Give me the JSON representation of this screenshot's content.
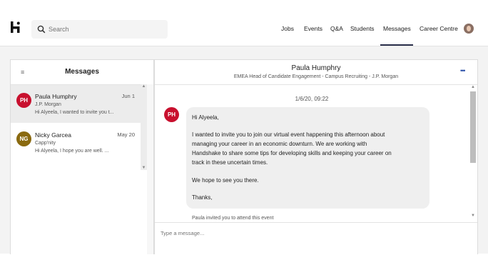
{
  "search": {
    "placeholder": "Search",
    "icon": "search-icon"
  },
  "nav": {
    "items": [
      "Jobs",
      "Events",
      "Q&A",
      "Students",
      "Messages",
      "Career Centre"
    ],
    "active": "Messages"
  },
  "messages_panel": {
    "title": "Messages",
    "menu_icon": "≡",
    "conversations": [
      {
        "initials": "PH",
        "name": "Paula Humphry",
        "date": "Jun 1",
        "subtitle": "J.P. Morgan",
        "preview": "Hi Alyeela, I wanted to invite you t...",
        "avatar_color": "#c8102e"
      },
      {
        "initials": "NG",
        "name": "Nicky Garcea",
        "date": "May 20",
        "subtitle": "Capp'nity",
        "preview": "Hi Alyeela, I hope you are well. ...",
        "avatar_color": "#8a6a10"
      }
    ]
  },
  "conversation": {
    "contact_name": "Paula Humphry",
    "contact_title": "EMEA Head of Candidate Engagement - Campus Recruiting - J.P. Morgan",
    "more_icon": "•••",
    "timestamp": "1/6/20, 09:22",
    "sender_initials": "PH",
    "message": {
      "greeting": "Hi Alyeela,",
      "line1": "I wanted to invite you to join our virtual event happening this afternoon about",
      "line2": "managing your career in an economic downturn. We are working with",
      "line3": "Handshake to share some tips for developing skills and keeping your career on",
      "line4": "track in these uncertain times.",
      "line5": "We hope to see you there.",
      "line6": "Thanks,"
    },
    "invite_note": "Paula invited you to attend this event",
    "compose_placeholder": "Type a message..."
  },
  "colors": {
    "accent": "#2a2f4b",
    "ph_avatar": "#c8102e",
    "ng_avatar": "#8a6a10"
  }
}
